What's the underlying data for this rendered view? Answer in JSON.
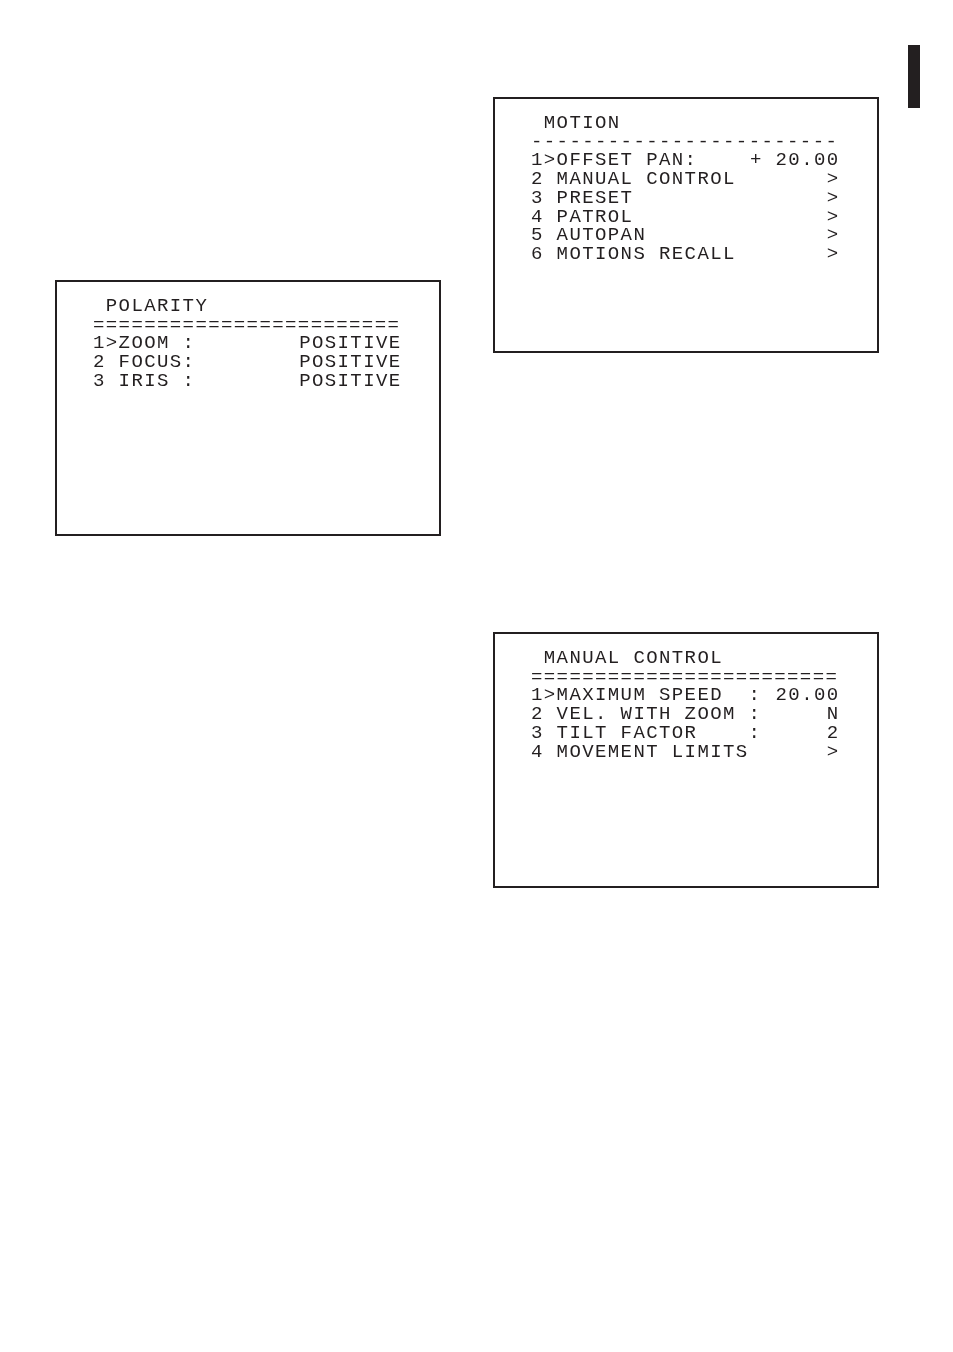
{
  "columns": [
    {
      "screens": [
        {
          "title": "POLARITY",
          "rule": "========================",
          "cursor": ">",
          "rows": [
            {
              "index": "1",
              "selected": true,
              "label": "ZOOM",
              "separator": ":",
              "value": "POSITIVE"
            },
            {
              "index": "2",
              "selected": false,
              "label": "FOCUS",
              "separator": ":",
              "value": "POSITIVE"
            },
            {
              "index": "3",
              "selected": false,
              "label": "IRIS",
              "separator": ":",
              "value": "POSITIVE"
            }
          ]
        }
      ]
    },
    {
      "screens": [
        {
          "title": "MOTION",
          "rule": "------------------------",
          "cursor": ">",
          "rows": [
            {
              "index": "1",
              "selected": true,
              "label": "OFFSET PAN",
              "separator": ":",
              "value": "+ 20.00"
            },
            {
              "index": "2",
              "selected": false,
              "label": "MANUAL CONTROL",
              "value": ">"
            },
            {
              "index": "3",
              "selected": false,
              "label": "PRESET",
              "value": ">"
            },
            {
              "index": "4",
              "selected": false,
              "label": "PATROL",
              "value": ">"
            },
            {
              "index": "5",
              "selected": false,
              "label": "AUTOPAN",
              "value": ">"
            },
            {
              "index": "6",
              "selected": false,
              "label": "MOTIONS RECALL",
              "value": ">"
            }
          ]
        },
        {
          "title": "MANUAL CONTROL",
          "rule": "========================",
          "cursor": ">",
          "rows": [
            {
              "index": "1",
              "selected": true,
              "label": "MAXIMUM SPEED",
              "separator": ":",
              "value": "20.00"
            },
            {
              "index": "2",
              "selected": false,
              "label": "VEL. WITH ZOOM",
              "separator": ":",
              "value": "N"
            },
            {
              "index": "3",
              "selected": false,
              "label": "TILT FACTOR",
              "separator": ":",
              "value": "2"
            },
            {
              "index": "4",
              "selected": false,
              "label": "MOVEMENT LIMITS",
              "value": ">"
            }
          ]
        }
      ]
    }
  ]
}
